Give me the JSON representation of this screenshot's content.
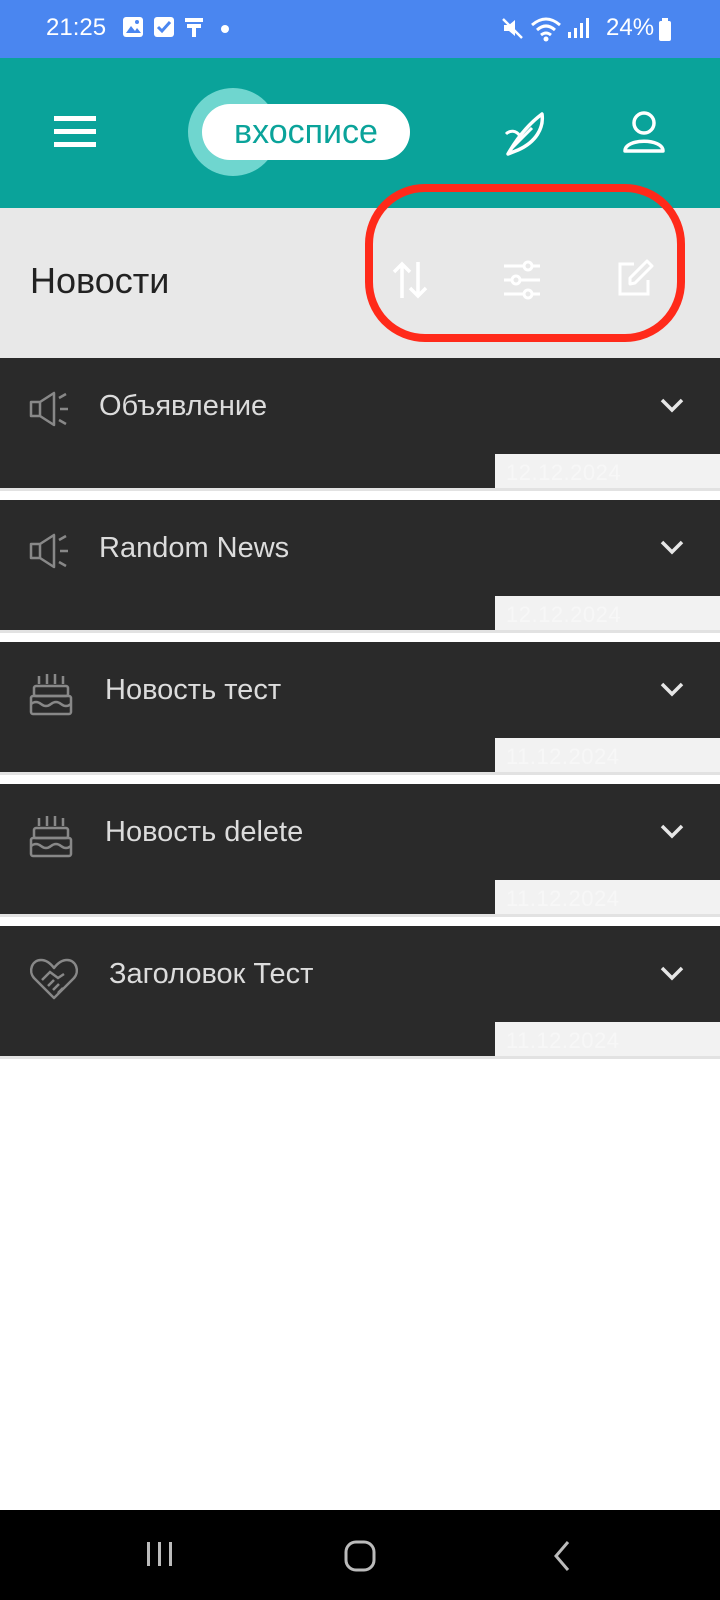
{
  "status_bar": {
    "time": "21:25",
    "battery": "24%"
  },
  "header": {
    "logo_text": "вхосписе"
  },
  "page": {
    "title": "Новости"
  },
  "news": [
    {
      "title": "Объявление",
      "date": "12.12.2024",
      "icon": "megaphone-icon"
    },
    {
      "title": "Random News",
      "date": "12.12.2024",
      "icon": "megaphone-icon"
    },
    {
      "title": "Новость тест",
      "date": "11.12.2024",
      "icon": "cake-icon"
    },
    {
      "title": "Новость delete",
      "date": "11.12.2024",
      "icon": "cake-icon"
    },
    {
      "title": "Заголовок Тест",
      "date": "11.12.2024",
      "icon": "handshake-heart-icon"
    }
  ],
  "colors": {
    "accent": "#0aa39a",
    "status_bar": "#4a86f0",
    "card": "#2a2a2a",
    "highlight": "#ff2a1a"
  }
}
